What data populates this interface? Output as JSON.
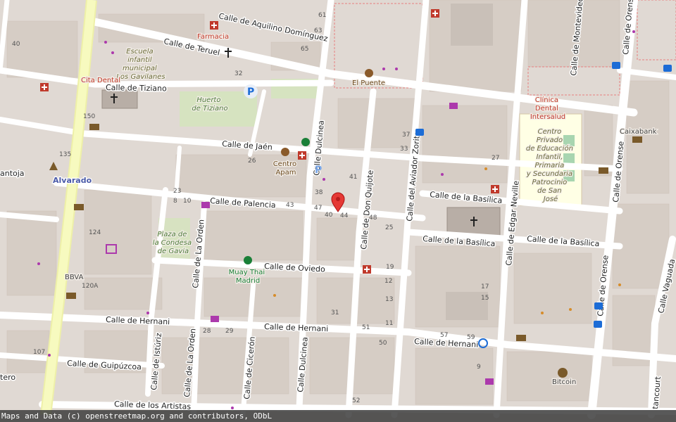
{
  "footer": {
    "attribution": "Maps and Data (c) openstreetmap.org and contributors, ODbL"
  },
  "colors": {
    "land": "#e0d9d3",
    "block": "#d9d0c9",
    "road": "#ffffff",
    "main_road": "#f7fabf",
    "park": "#cdebb0",
    "school": "#ffffe5",
    "marker": "#e53935",
    "poi_red": "#c0392b",
    "poi_green": "#1a7f37"
  },
  "streets": {
    "aquilino": "Calle de Aquilino Domínguez",
    "teruel": "Calle de Teruel",
    "tiziano": "Calle de Tiziano",
    "jaen": "Calle de Jaén",
    "dulcinea_n": "Calle Dulcinea",
    "don_quijote": "Calle de Don Quijote",
    "aviador_zorita": "Calle del Aviador Zorita",
    "basilica_1": "Calle de la Basílica",
    "basilica_2": "Calle de la Basílica",
    "basilica_3": "Calle de la Basílica",
    "edgar_neville": "Calle de Edgar Neville",
    "montevideo": "Calle de Montevideo",
    "orense_1": "Calle de Orense",
    "orense_2": "Calle de Orense",
    "orense_3": "Calle de Orense",
    "palencia": "Calle de Palencia",
    "oviedo": "Calle de Oviedo",
    "la_orden_1": "Calle de La Orden",
    "la_orden_2": "Calle de La Orden",
    "hernani_1": "Calle de Hernani",
    "hernani_2": "Calle de Hernani",
    "hernani_3": "Calle de Hernani",
    "guipuzcoa": "Calle de Guipúzcoa",
    "isturiz": "Calle de Istúriz",
    "ciceron": "Calle de Cicerón",
    "dulcinea_s": "Calle Dulcinea",
    "artistas": "Calle de los Artistas",
    "vaguada": "Calle Vaguada",
    "antoja": "antoja",
    "tero": "tero",
    "tancourt": "tancourt"
  },
  "places": {
    "farmacia": "Farmacia",
    "escuela": [
      "Escuela",
      "infantil",
      "municipal",
      "Los Gavilanes"
    ],
    "cita_dental": "Cita Dental",
    "huerto": [
      "Huerto",
      "de Tiziano"
    ],
    "el_puente": "El Puente",
    "clinica": [
      "Clínica",
      "Dental",
      "Intersalud"
    ],
    "centro_privado": [
      "Centro",
      "Privado",
      "de Educación",
      "Infantil,",
      "Primaria",
      "y Secundaria",
      "Patrocinio",
      "de San",
      "José"
    ],
    "caixabank": "Caixabank",
    "centro_apam": [
      "Centro",
      "Apam"
    ],
    "alvarado": "Alvarado",
    "plaza": [
      "Plaza de",
      "la Condesa",
      "de Gavia"
    ],
    "muay_thai": [
      "Muay Thai",
      "Madrid"
    ],
    "bbva": "BBVA",
    "bitcoin": "Bitcoin"
  },
  "house_numbers": {
    "n61": "61",
    "n63": "63",
    "n65": "65",
    "n40a": "40",
    "n32": "32",
    "n150": "150",
    "n135": "135",
    "n124": "124",
    "n120a": "120A",
    "n107": "107",
    "n26": "26",
    "n27": "27",
    "n23": "23",
    "n8": "8",
    "n10": "10",
    "n43": "43",
    "n47": "47",
    "n40": "40",
    "n44": "44",
    "n48": "48",
    "n25": "25",
    "n37": "37",
    "n33": "33",
    "n41": "41",
    "n38": "38",
    "n19": "19",
    "n17": "17",
    "n15": "15",
    "n57": "57",
    "n59": "59",
    "n51": "51",
    "n50": "50",
    "n52": "52",
    "n9": "9",
    "n28": "28",
    "n29": "29",
    "n31": "31",
    "n11": "11",
    "n13": "13",
    "n12": "12"
  },
  "marker": {
    "icon": "map-pin-icon"
  }
}
